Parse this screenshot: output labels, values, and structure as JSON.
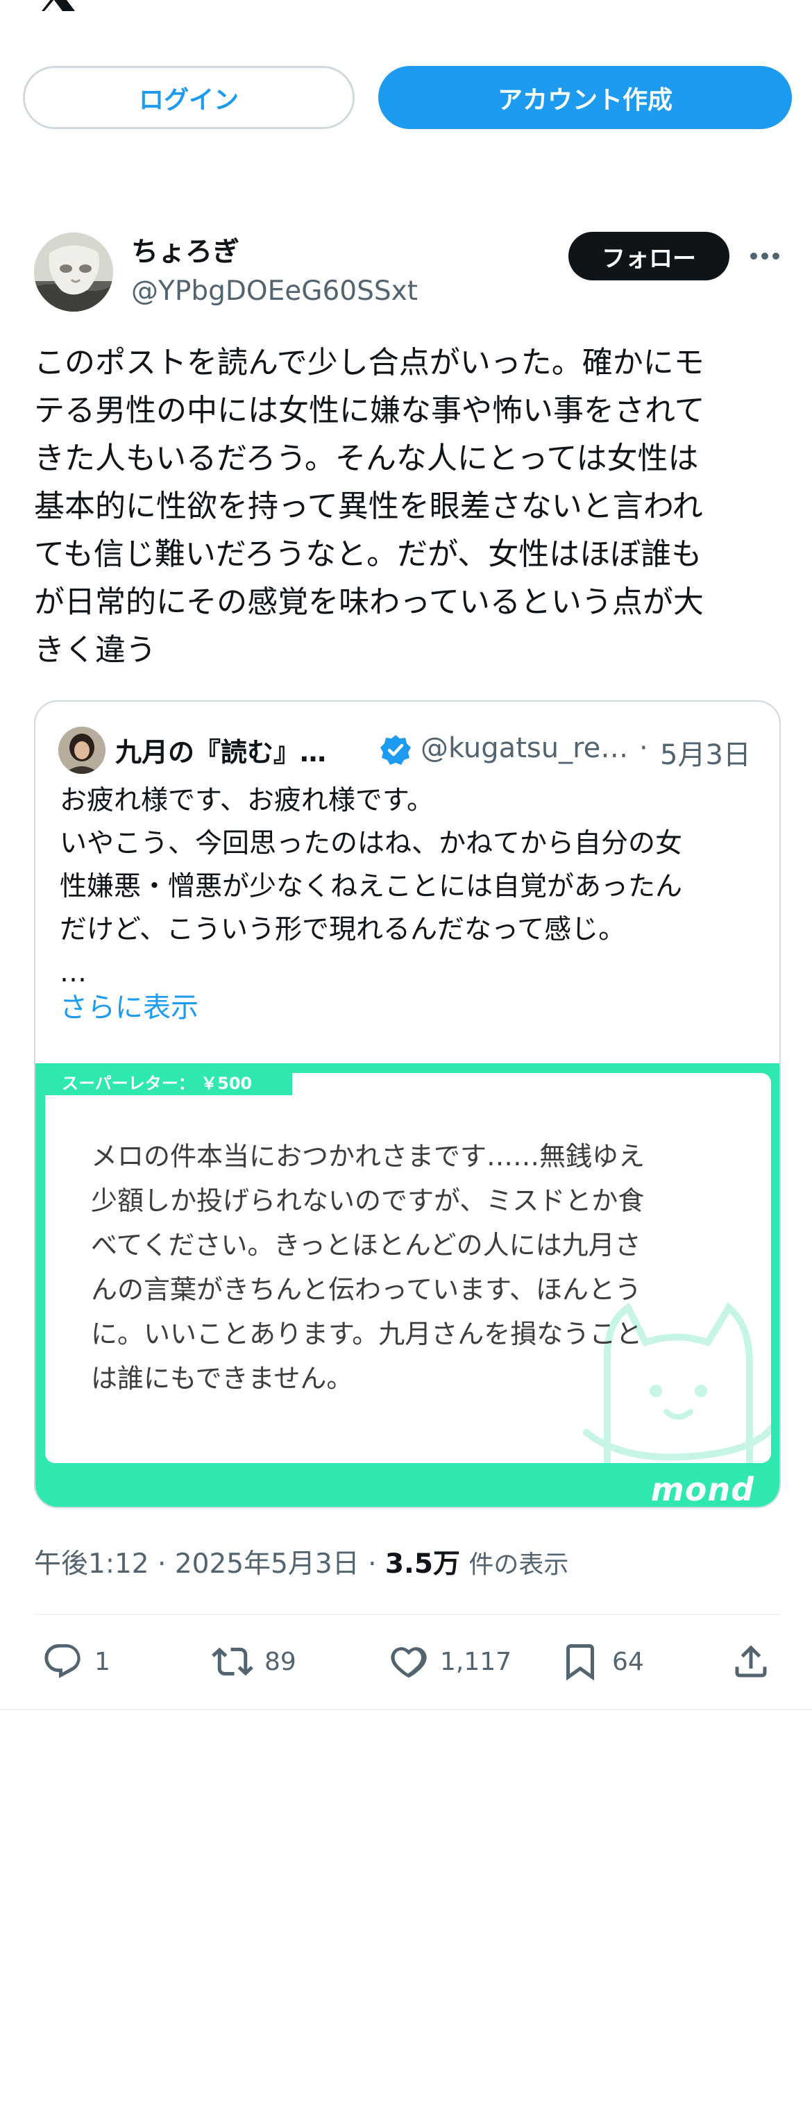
{
  "header": {
    "logo_icon": "x-logo-icon",
    "login_label": "ログイン",
    "signup_label": "アカウント作成"
  },
  "post": {
    "author": {
      "display_name": "ちょろぎ",
      "handle": "@YPbgDOEeG60SSxt"
    },
    "follow_label": "フォロー",
    "text": "このポストを読んで少し合点がいった。確かにモ\nテる男性の中には女性に嫌な事や怖い事をされて\nきた人もいるだろう。そんな人にとっては女性は\n基本的に性欲を持って異性を眼差さないと言われ\nても信じ難いだろうなと。だが、女性はほぼ誰も\nが日常的にその感覚を味わっているという点が大\nきく違う",
    "quote": {
      "name": "九月の『読む』…",
      "handle": "@kugatsu_re…",
      "separator": "·",
      "date": "5月3日",
      "text": "お疲れ様です、お疲れ様です。\nいやこう、今回思ったのはね、かねてから自分の女\n性嫌悪・憎悪が少なくねえことには自覚があったん\nだけど、こういう形で現れるんだなって感じ。\n…",
      "show_more": "さらに表示",
      "letter": {
        "tag": "スーパーレター： ￥500",
        "text": "メロの件本当におつかれさまです……無銭ゆえ\n少額しか投げられないのですが、ミスドとか食\nべてください。きっとほとんどの人には九月さ\nんの言葉がきちんと伝わっています、ほんとう\nに。いいことあります。九月さんを損なうこと\nは誰にもできません。",
        "brand": "mond"
      }
    },
    "meta": {
      "time": "午後1:12",
      "sep": "·",
      "date": "2025年5月3日",
      "sep2": "·",
      "views_count": "3.5万",
      "views_label": "件の表示"
    },
    "actions": {
      "replies": "1",
      "reposts": "89",
      "likes": "1,117",
      "bookmarks": "64"
    }
  },
  "colors": {
    "accent": "#1d9bf0",
    "letter_frame": "#2ee8b0",
    "text_secondary": "#536471"
  }
}
